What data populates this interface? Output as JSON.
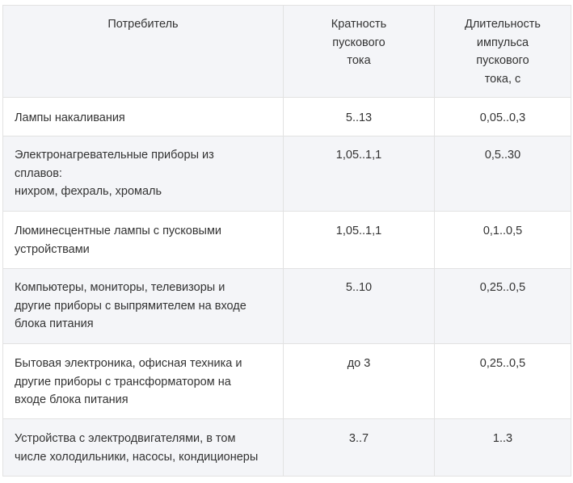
{
  "table": {
    "headers": [
      [
        "Потребитель"
      ],
      [
        "Кратность",
        "пускового",
        "тока"
      ],
      [
        "Длительность",
        "импульса",
        "пускового",
        "тока, с"
      ]
    ],
    "rows": [
      {
        "consumer": [
          "Лампы накаливания"
        ],
        "multiplicity": "5..13",
        "duration": "0,05..0,3"
      },
      {
        "consumer": [
          "Электронагревательные приборы из",
          "сплавов:",
          "нихром, фехраль, хромаль"
        ],
        "multiplicity": "1,05..1,1",
        "duration": "0,5..30"
      },
      {
        "consumer": [
          "Люминесцентные лампы с пусковыми",
          "устройствами"
        ],
        "multiplicity": "1,05..1,1",
        "duration": "0,1..0,5"
      },
      {
        "consumer": [
          "Компьютеры, мониторы, телевизоры и",
          "другие приборы с выпрямителем на входе",
          "блока питания"
        ],
        "multiplicity": "5..10",
        "duration": "0,25..0,5"
      },
      {
        "consumer": [
          "Бытовая электроника, офисная техника и",
          "другие приборы с трансформатором на",
          "входе блока питания"
        ],
        "multiplicity": "до 3",
        "duration": "0,25..0,5"
      },
      {
        "consumer": [
          "Устройства с электродвигателями, в том",
          "числе холодильники, насосы, кондиционеры"
        ],
        "multiplicity": "3..7",
        "duration": "1..3"
      }
    ]
  }
}
